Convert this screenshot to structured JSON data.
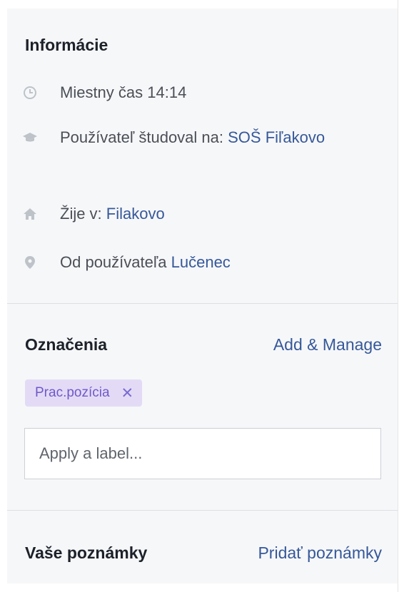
{
  "info": {
    "title": "Informácie",
    "rows": [
      {
        "icon": "clock-icon",
        "text": "Miestny čas 14:14",
        "link": ""
      },
      {
        "icon": "graduation-cap-icon",
        "text": "Používateľ študoval na: ",
        "link": "SOŠ Fiľakovo"
      },
      {
        "icon": "home-icon",
        "text": "Žije v: ",
        "link": "Filakovo"
      },
      {
        "icon": "location-pin-icon",
        "text": "Od používateľa ",
        "link": "Lučenec"
      }
    ]
  },
  "labels": {
    "title": "Označenia",
    "action": "Add & Manage",
    "tags": [
      {
        "text": "Prac.pozícia",
        "remove": "✕"
      }
    ],
    "input_placeholder": "Apply a label..."
  },
  "notes": {
    "title": "Vaše poznámky",
    "action": "Pridať poznámky"
  },
  "colors": {
    "link": "#365899",
    "tag_bg": "#e3dbf6",
    "tag_text": "#7158c9",
    "icon": "#bec3c9"
  }
}
